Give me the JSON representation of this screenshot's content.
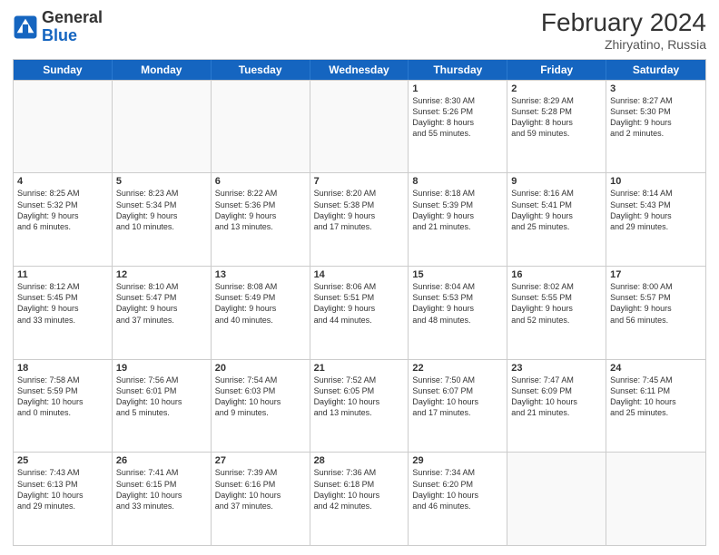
{
  "header": {
    "logo_general": "General",
    "logo_blue": "Blue",
    "month_year": "February 2024",
    "location": "Zhiryatino, Russia"
  },
  "weekdays": [
    "Sunday",
    "Monday",
    "Tuesday",
    "Wednesday",
    "Thursday",
    "Friday",
    "Saturday"
  ],
  "rows": [
    [
      {
        "day": "",
        "content": ""
      },
      {
        "day": "",
        "content": ""
      },
      {
        "day": "",
        "content": ""
      },
      {
        "day": "",
        "content": ""
      },
      {
        "day": "1",
        "content": "Sunrise: 8:30 AM\nSunset: 5:26 PM\nDaylight: 8 hours\nand 55 minutes."
      },
      {
        "day": "2",
        "content": "Sunrise: 8:29 AM\nSunset: 5:28 PM\nDaylight: 8 hours\nand 59 minutes."
      },
      {
        "day": "3",
        "content": "Sunrise: 8:27 AM\nSunset: 5:30 PM\nDaylight: 9 hours\nand 2 minutes."
      }
    ],
    [
      {
        "day": "4",
        "content": "Sunrise: 8:25 AM\nSunset: 5:32 PM\nDaylight: 9 hours\nand 6 minutes."
      },
      {
        "day": "5",
        "content": "Sunrise: 8:23 AM\nSunset: 5:34 PM\nDaylight: 9 hours\nand 10 minutes."
      },
      {
        "day": "6",
        "content": "Sunrise: 8:22 AM\nSunset: 5:36 PM\nDaylight: 9 hours\nand 13 minutes."
      },
      {
        "day": "7",
        "content": "Sunrise: 8:20 AM\nSunset: 5:38 PM\nDaylight: 9 hours\nand 17 minutes."
      },
      {
        "day": "8",
        "content": "Sunrise: 8:18 AM\nSunset: 5:39 PM\nDaylight: 9 hours\nand 21 minutes."
      },
      {
        "day": "9",
        "content": "Sunrise: 8:16 AM\nSunset: 5:41 PM\nDaylight: 9 hours\nand 25 minutes."
      },
      {
        "day": "10",
        "content": "Sunrise: 8:14 AM\nSunset: 5:43 PM\nDaylight: 9 hours\nand 29 minutes."
      }
    ],
    [
      {
        "day": "11",
        "content": "Sunrise: 8:12 AM\nSunset: 5:45 PM\nDaylight: 9 hours\nand 33 minutes."
      },
      {
        "day": "12",
        "content": "Sunrise: 8:10 AM\nSunset: 5:47 PM\nDaylight: 9 hours\nand 37 minutes."
      },
      {
        "day": "13",
        "content": "Sunrise: 8:08 AM\nSunset: 5:49 PM\nDaylight: 9 hours\nand 40 minutes."
      },
      {
        "day": "14",
        "content": "Sunrise: 8:06 AM\nSunset: 5:51 PM\nDaylight: 9 hours\nand 44 minutes."
      },
      {
        "day": "15",
        "content": "Sunrise: 8:04 AM\nSunset: 5:53 PM\nDaylight: 9 hours\nand 48 minutes."
      },
      {
        "day": "16",
        "content": "Sunrise: 8:02 AM\nSunset: 5:55 PM\nDaylight: 9 hours\nand 52 minutes."
      },
      {
        "day": "17",
        "content": "Sunrise: 8:00 AM\nSunset: 5:57 PM\nDaylight: 9 hours\nand 56 minutes."
      }
    ],
    [
      {
        "day": "18",
        "content": "Sunrise: 7:58 AM\nSunset: 5:59 PM\nDaylight: 10 hours\nand 0 minutes."
      },
      {
        "day": "19",
        "content": "Sunrise: 7:56 AM\nSunset: 6:01 PM\nDaylight: 10 hours\nand 5 minutes."
      },
      {
        "day": "20",
        "content": "Sunrise: 7:54 AM\nSunset: 6:03 PM\nDaylight: 10 hours\nand 9 minutes."
      },
      {
        "day": "21",
        "content": "Sunrise: 7:52 AM\nSunset: 6:05 PM\nDaylight: 10 hours\nand 13 minutes."
      },
      {
        "day": "22",
        "content": "Sunrise: 7:50 AM\nSunset: 6:07 PM\nDaylight: 10 hours\nand 17 minutes."
      },
      {
        "day": "23",
        "content": "Sunrise: 7:47 AM\nSunset: 6:09 PM\nDaylight: 10 hours\nand 21 minutes."
      },
      {
        "day": "24",
        "content": "Sunrise: 7:45 AM\nSunset: 6:11 PM\nDaylight: 10 hours\nand 25 minutes."
      }
    ],
    [
      {
        "day": "25",
        "content": "Sunrise: 7:43 AM\nSunset: 6:13 PM\nDaylight: 10 hours\nand 29 minutes."
      },
      {
        "day": "26",
        "content": "Sunrise: 7:41 AM\nSunset: 6:15 PM\nDaylight: 10 hours\nand 33 minutes."
      },
      {
        "day": "27",
        "content": "Sunrise: 7:39 AM\nSunset: 6:16 PM\nDaylight: 10 hours\nand 37 minutes."
      },
      {
        "day": "28",
        "content": "Sunrise: 7:36 AM\nSunset: 6:18 PM\nDaylight: 10 hours\nand 42 minutes."
      },
      {
        "day": "29",
        "content": "Sunrise: 7:34 AM\nSunset: 6:20 PM\nDaylight: 10 hours\nand 46 minutes."
      },
      {
        "day": "",
        "content": ""
      },
      {
        "day": "",
        "content": ""
      }
    ]
  ]
}
